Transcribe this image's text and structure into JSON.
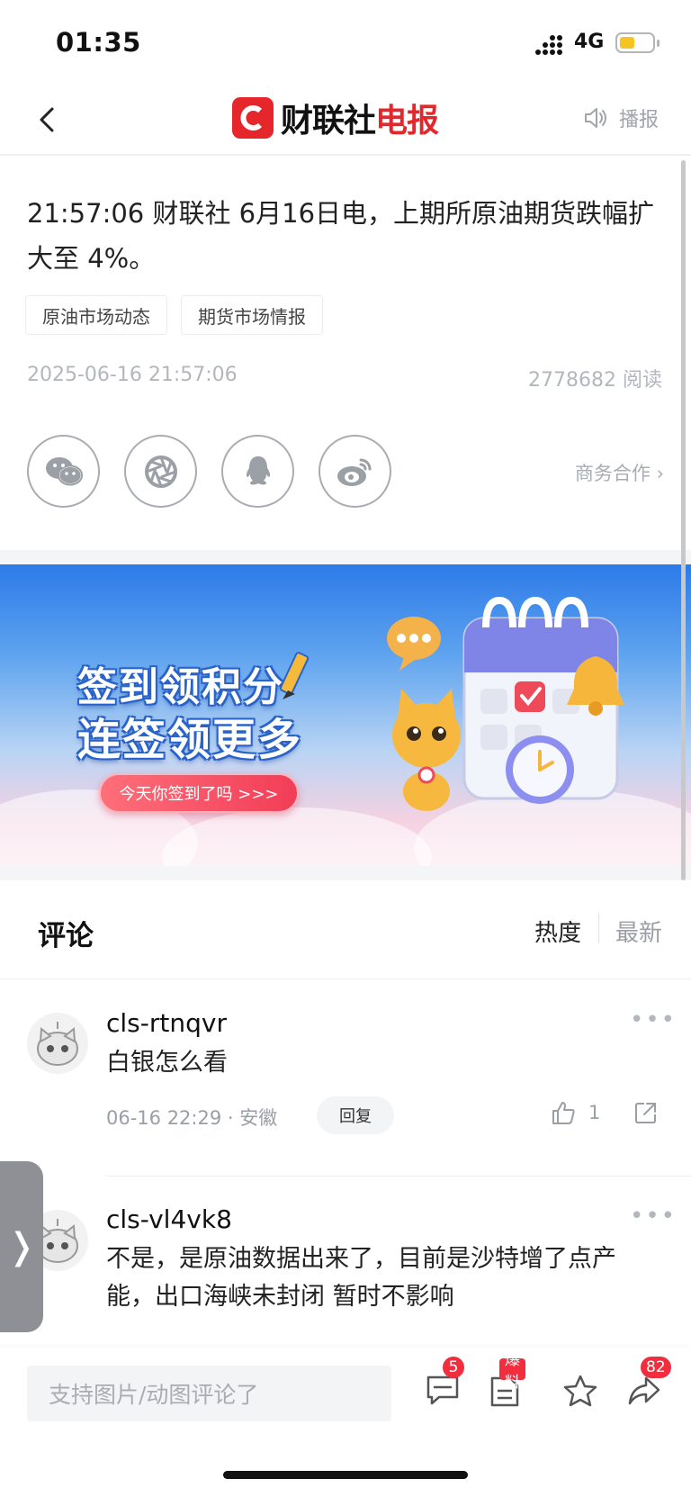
{
  "status_bar": {
    "time": "01:35",
    "network": "4G"
  },
  "nav": {
    "brand_black": "财联社",
    "brand_red": "电报",
    "broadcast_label": "播报"
  },
  "article": {
    "text": "21:57:06 财联社 6月16日电，上期所原油期货跌幅扩大至 4%。",
    "tags": [
      "原油市场动态",
      "期货市场情报"
    ],
    "date": "2025-06-16 21:57:06",
    "reads": "2778682 阅读",
    "business_label": "商务合作 ›"
  },
  "share_icons": [
    "wechat-icon",
    "moments-icon",
    "qq-icon",
    "weibo-icon"
  ],
  "banner": {
    "line1": "签到领积分",
    "line2": "连签领更多",
    "cta": "今天你签到了吗  >>>"
  },
  "comments_section": {
    "title": "评论",
    "sort_hot": "热度",
    "sort_new": "最新",
    "items": [
      {
        "user": "cls-rtnqvr",
        "text": "白银怎么看",
        "meta": "06-16 22:29 · 安徽",
        "reply_label": "回复",
        "likes": "1",
        "more": "•••"
      },
      {
        "user": "cls-vl4vk8",
        "text": "不是，是原油数据出来了，目前是沙特增了点产能，出口海峡未封闭 暂时不影响",
        "more": "•••"
      }
    ]
  },
  "bottom_bar": {
    "input_placeholder": "支持图片/动图评论了",
    "comment_count": "5",
    "tipoff_label": "爆料",
    "share_count": "82"
  },
  "side_tab": {
    "label": "❭"
  },
  "colors": {
    "brand_red": "#e5262a",
    "badge_red": "#f22d3d",
    "muted": "#b3b7bd"
  }
}
